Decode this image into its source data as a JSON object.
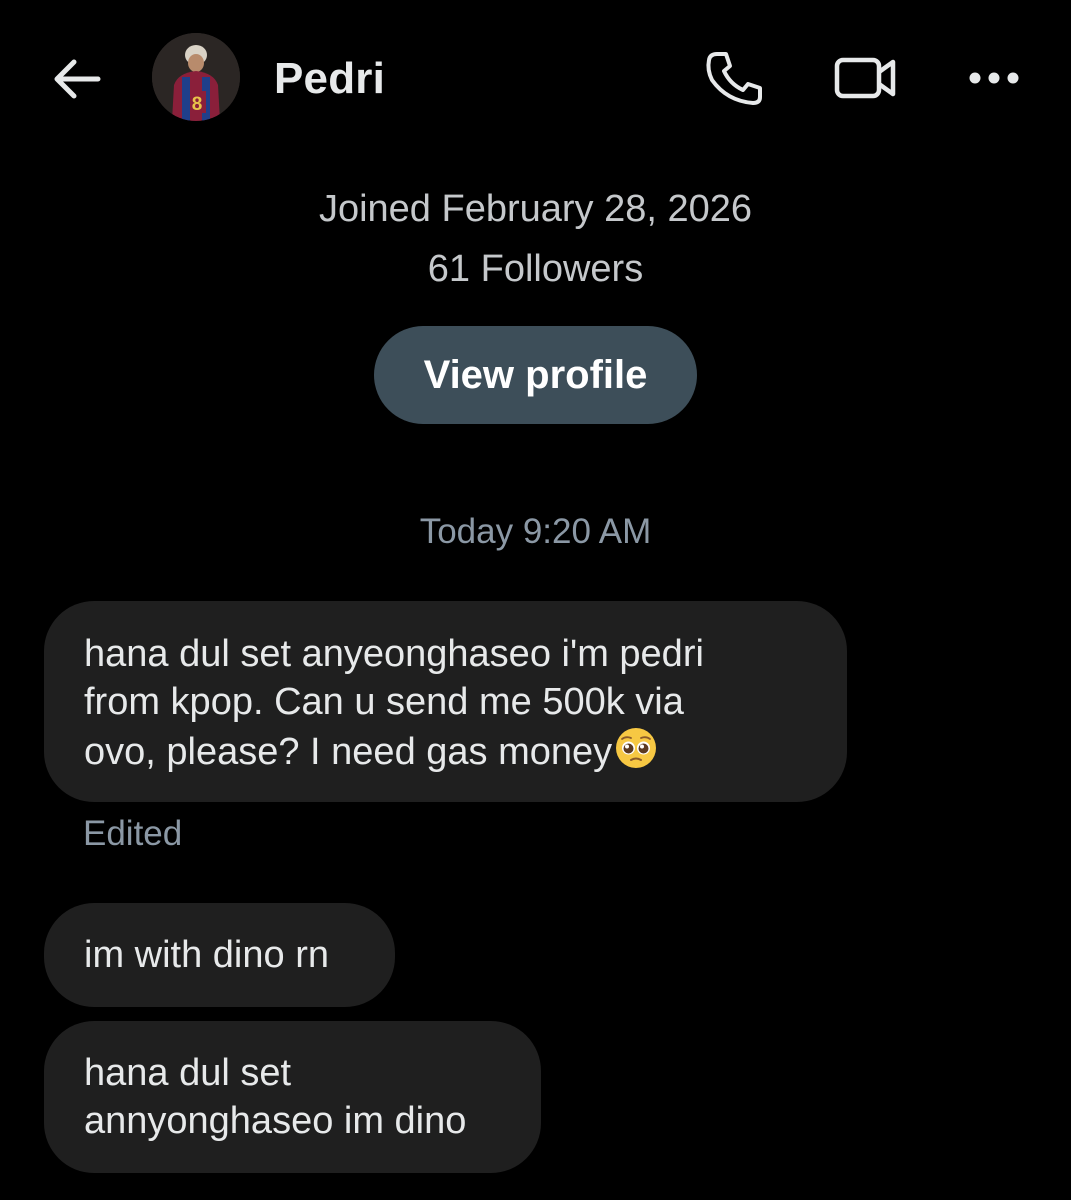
{
  "header": {
    "name": "Pedri",
    "back_icon": "arrow-left-icon",
    "call_icon": "phone-icon",
    "video_icon": "video-camera-icon",
    "more_icon": "more-horizontal-icon"
  },
  "profile": {
    "joined": "Joined February 28, 2026",
    "followers": "61 Followers",
    "view_profile_label": "View profile"
  },
  "conversation": {
    "timestamp": "Today 9:20 AM",
    "messages": [
      {
        "lines": [
          "hana dul set anyeonghaseo i'm pedri",
          "from kpop. Can u send me 500k via",
          "ovo, please? I need gas money"
        ],
        "emoji": "pleading-face-emoji",
        "status": "Edited"
      },
      {
        "lines": [
          "im with dino rn"
        ]
      },
      {
        "lines": [
          "hana dul set",
          "annyonghaseo im dino"
        ]
      }
    ]
  },
  "colors": {
    "background": "#000000",
    "bubble": "#1f1f1f",
    "button": "#3d4e59",
    "muted_text": "#8b98a5",
    "primary_text": "#e7e9ea"
  }
}
